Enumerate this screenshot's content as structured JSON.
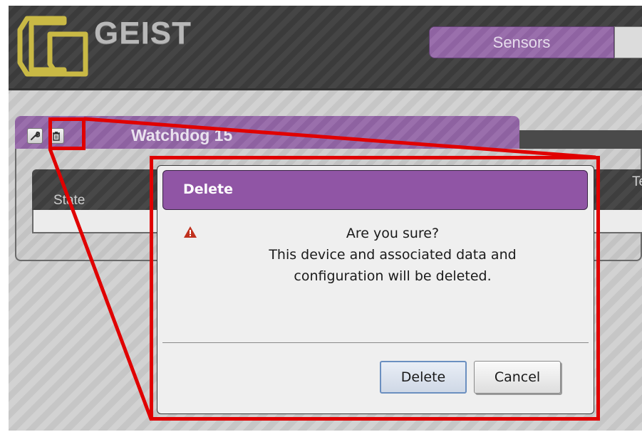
{
  "header": {
    "brand": "GEIST",
    "tabs": [
      {
        "label": "Sensors"
      }
    ]
  },
  "panel": {
    "title": "Watchdog 15",
    "icons": [
      "wrench-icon",
      "trash-icon"
    ],
    "table": {
      "columns": [
        "State",
        "Te"
      ]
    }
  },
  "dialog": {
    "title": "Delete",
    "icon": "warning-icon",
    "message_lines": [
      "Are you sure?",
      "This device and associated data and",
      "configuration will be deleted."
    ],
    "buttons": {
      "delete": "Delete",
      "cancel": "Cancel"
    }
  },
  "colors": {
    "accent_purple": "#9055a5",
    "annotation_red": "#e00000",
    "logo_yellow": "#c8b84a"
  }
}
